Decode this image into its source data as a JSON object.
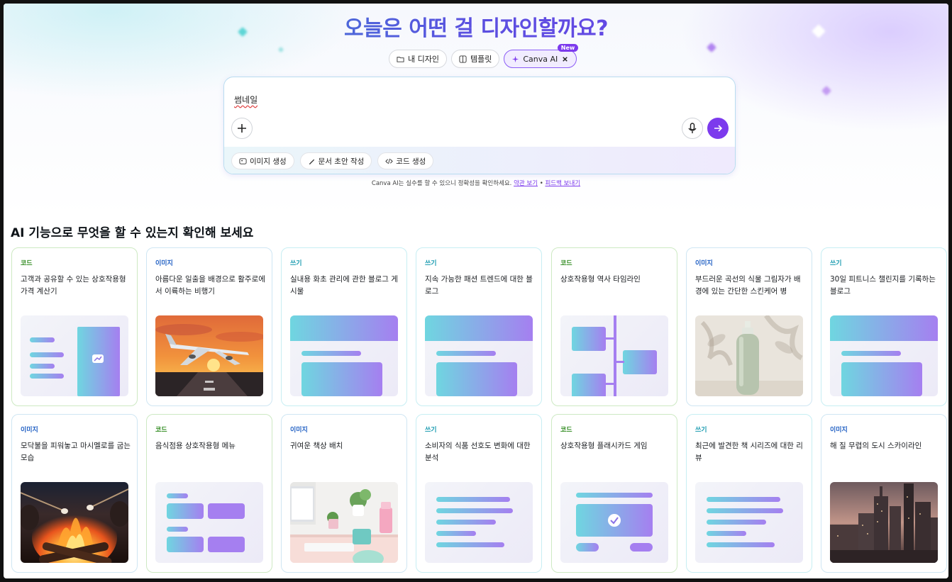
{
  "headline": "오늘은 어떤 걸 디자인할까요?",
  "tabs": [
    {
      "label": "내 디자인"
    },
    {
      "label": "템플릿"
    },
    {
      "label": "Canva AI",
      "badge": "New"
    }
  ],
  "prompt": {
    "text": "썸네일",
    "chips": [
      "이미지 생성",
      "문서 초안 작성",
      "코드 생성"
    ]
  },
  "disclaimer": {
    "text": "Canva AI는 실수를 할 수 있으니 정확성을 확인하세요.",
    "terms_link": "약관 보기",
    "separator": "•",
    "feedback_link": "피드백 보내기"
  },
  "section_title": "AI 기능으로 무엇을 할 수 있는지 확인해 보세요",
  "colors": {
    "accent": "#7c3aed",
    "code": "#2f8a1e",
    "image": "#2160c4",
    "write": "#1a9bb0"
  },
  "cards_row1": [
    {
      "category": "코드",
      "desc": "고객과 공유할 수 있는 상호작용형 가격 계산기"
    },
    {
      "category": "이미지",
      "desc": "아름다운 일출을 배경으로 활주로에서 이륙하는 비행기"
    },
    {
      "category": "쓰기",
      "desc": "실내용 화초 관리에 관한 블로그 게시물"
    },
    {
      "category": "쓰기",
      "desc": "지속 가능한 패션 트렌드에 대한 블로그"
    },
    {
      "category": "코드",
      "desc": "상호작용형 역사 타임라인"
    },
    {
      "category": "이미지",
      "desc": "부드러운 곡선의 식물 그림자가 배경에 있는 간단한 스킨케어 병"
    },
    {
      "category": "쓰기",
      "desc": "30일 피트니스 챌린지를 기록하는 블로그"
    }
  ],
  "cards_row2": [
    {
      "category": "이미지",
      "desc": "모닥불을 피워놓고 마시멜로를 굽는 모습"
    },
    {
      "category": "코드",
      "desc": "음식점용 상호작용형 메뉴"
    },
    {
      "category": "이미지",
      "desc": "귀여운 책상 배치"
    },
    {
      "category": "쓰기",
      "desc": "소비자의 식품 선호도 변화에 대한 분석"
    },
    {
      "category": "코드",
      "desc": "상호작용형 플래시카드 게임"
    },
    {
      "category": "쓰기",
      "desc": "최근에 발견한 책 시리즈에 대한 리뷰"
    },
    {
      "category": "이미지",
      "desc": "해 질 무렵의 도시 스카이라인"
    }
  ]
}
